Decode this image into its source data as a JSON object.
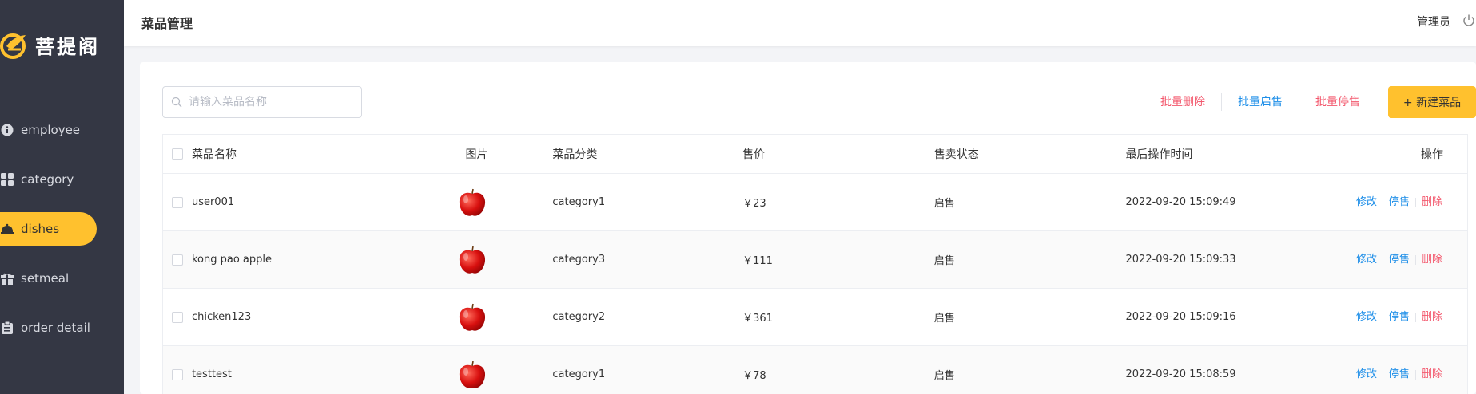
{
  "brand": {
    "name": "菩提阁"
  },
  "sidebar": {
    "items": [
      {
        "label": "employee",
        "icon": "info-icon",
        "active": false
      },
      {
        "label": "category",
        "icon": "grid-icon",
        "active": false
      },
      {
        "label": "dishes",
        "icon": "dish-cover-icon",
        "active": true
      },
      {
        "label": "setmeal",
        "icon": "gift-icon",
        "active": false
      },
      {
        "label": "order detail",
        "icon": "clipboard-icon",
        "active": false
      }
    ]
  },
  "header": {
    "title": "菜品管理",
    "user": "管理员",
    "logout_icon": "power-icon"
  },
  "toolbar": {
    "search_placeholder": "请输入菜品名称",
    "batch_delete": "批量删除",
    "batch_enable": "批量启售",
    "batch_disable": "批量停售",
    "new_dish": "+ 新建菜品"
  },
  "table": {
    "columns": [
      "菜品名称",
      "图片",
      "菜品分类",
      "售价",
      "售卖状态",
      "最后操作时间",
      "操作"
    ],
    "rows": [
      {
        "name": "user001",
        "category": "category1",
        "price": "￥23",
        "status": "启售",
        "time": "2022-09-20 15:09:49"
      },
      {
        "name": "kong pao apple",
        "category": "category3",
        "price": "￥111",
        "status": "启售",
        "time": "2022-09-20 15:09:33"
      },
      {
        "name": "chicken123",
        "category": "category2",
        "price": "￥361",
        "status": "启售",
        "time": "2022-09-20 15:09:16"
      },
      {
        "name": "testtest",
        "category": "category1",
        "price": "￥78",
        "status": "启售",
        "time": "2022-09-20 15:08:59"
      }
    ],
    "row_actions": {
      "edit": "修改",
      "disable": "停售",
      "delete": "删除"
    }
  },
  "colors": {
    "sidebar_bg": "#343744",
    "accent": "#ffc12e",
    "link_blue": "#1d8ee8",
    "danger_red": "#f3586d"
  }
}
